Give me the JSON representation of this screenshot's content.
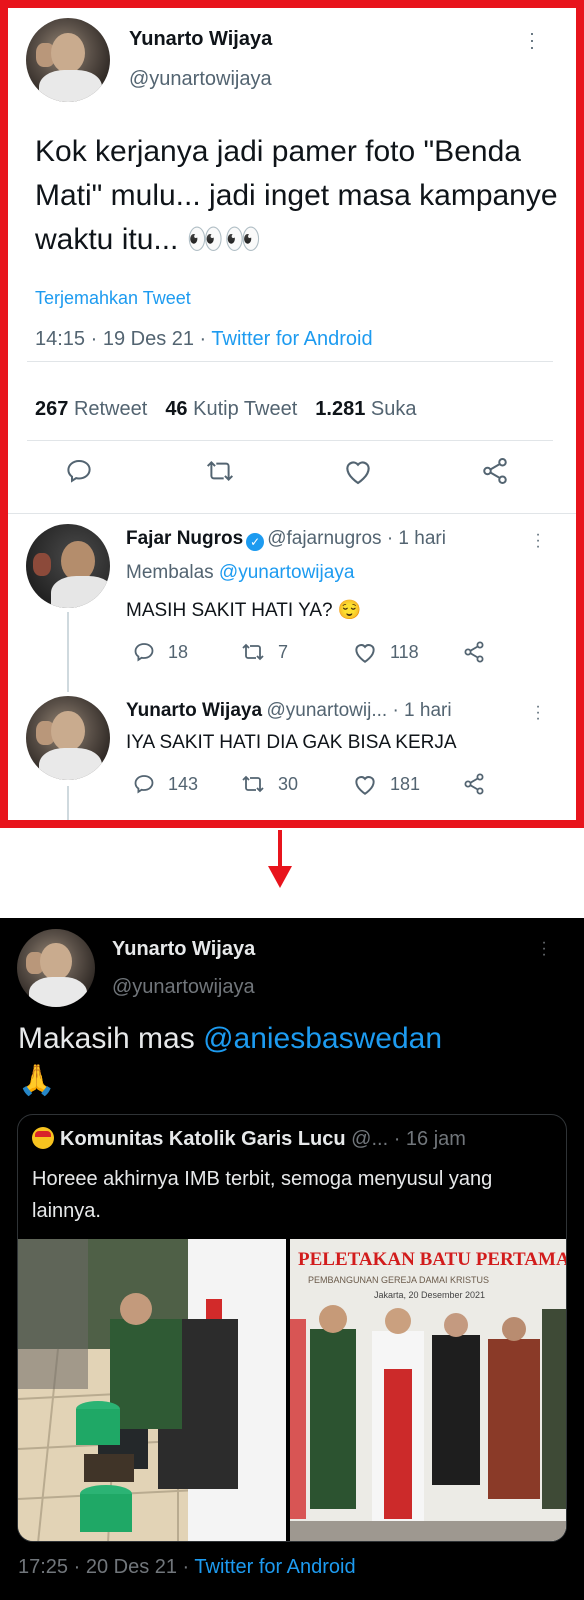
{
  "top_tweet": {
    "author_name": "Yunarto Wijaya",
    "author_handle": "@yunartowijaya",
    "text": "Kok kerjanya jadi pamer foto \"Benda Mati\" mulu... jadi inget masa kampanye waktu itu... 👀👀",
    "translate_label": "Terjemahkan Tweet",
    "timestamp": "14:15 · 19 Des 21 · ",
    "source": "Twitter for Android",
    "retweets_count": "267",
    "retweets_label": "Retweet",
    "quotes_count": "46",
    "quotes_label": "Kutip Tweet",
    "likes_count": "1.281",
    "likes_label": "Suka"
  },
  "replies": [
    {
      "author_name": "Fajar Nugros",
      "verified": true,
      "author_handle": "@fajarnugros · 1 hari",
      "reply_to_prefix": "Membalas ",
      "reply_to_handle": "@yunartowijaya",
      "text": "MASIH SAKIT HATI YA? 😌",
      "reply_count": "18",
      "retweet_count": "7",
      "like_count": "118"
    },
    {
      "author_name": "Yunarto Wijaya",
      "verified": false,
      "author_handle": "@yunartowij... · 1 hari",
      "text": "IYA SAKIT HATI DIA GAK BISA KERJA",
      "reply_count": "143",
      "retweet_count": "30",
      "like_count": "181"
    }
  ],
  "dark_tweet": {
    "author_name": "Yunarto Wijaya",
    "author_handle": "@yunartowijaya",
    "text_prefix": "Makasih mas ",
    "mention": "@aniesbaswedan",
    "emoji": "🙏",
    "quoted": {
      "author_name": "Komunitas Katolik Garis Lucu",
      "author_handle": "@... · 16 jam",
      "text": "Horeee akhirnya IMB terbit, semoga menyusul yang lainnya.",
      "photo2_banner_title": "PELETAKAN BATU PERTAMA",
      "photo2_banner_sub": "PEMBANGUNAN GEREJA DAMAI KRISTUS",
      "photo2_banner_date": "Jakarta, 20 Desember 2021"
    },
    "timestamp": "17:25 · 20 Des 21 · ",
    "source": "Twitter for Android"
  },
  "colors": {
    "frame": "#e8141c",
    "link": "#1d9bf0",
    "dark_bg": "#000000"
  },
  "icons": [
    "more-icon",
    "reply-icon",
    "retweet-icon",
    "like-icon",
    "share-icon",
    "verified-icon",
    "pray-emoji",
    "arrow-down"
  ]
}
